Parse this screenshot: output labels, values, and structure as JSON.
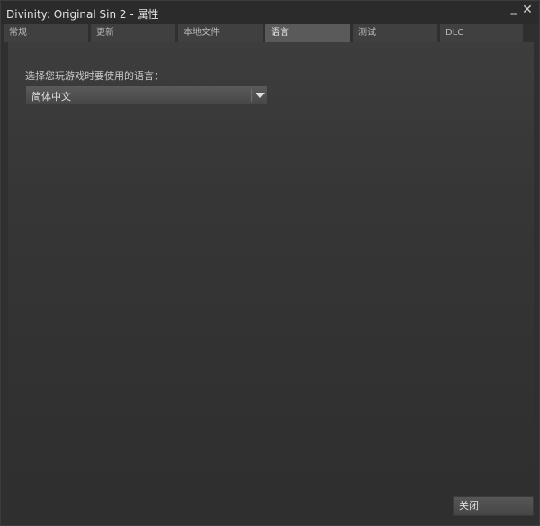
{
  "window": {
    "title": "Divinity: Original Sin 2 - 属性",
    "minimize_glyph": "_",
    "close_glyph": "✕"
  },
  "tabs": [
    {
      "label": "常规",
      "active": false
    },
    {
      "label": "更新",
      "active": false
    },
    {
      "label": "本地文件",
      "active": false
    },
    {
      "label": "语言",
      "active": true
    },
    {
      "label": "测试",
      "active": false
    },
    {
      "label": "DLC",
      "active": false
    }
  ],
  "language": {
    "prompt": "选择您玩游戏时要使用的语言：",
    "selected": "简体中文"
  },
  "footer": {
    "close_label": "关闭"
  },
  "icons": {
    "dropdown": "chevron-down-icon",
    "minimize": "minimize-icon",
    "close": "close-icon"
  }
}
